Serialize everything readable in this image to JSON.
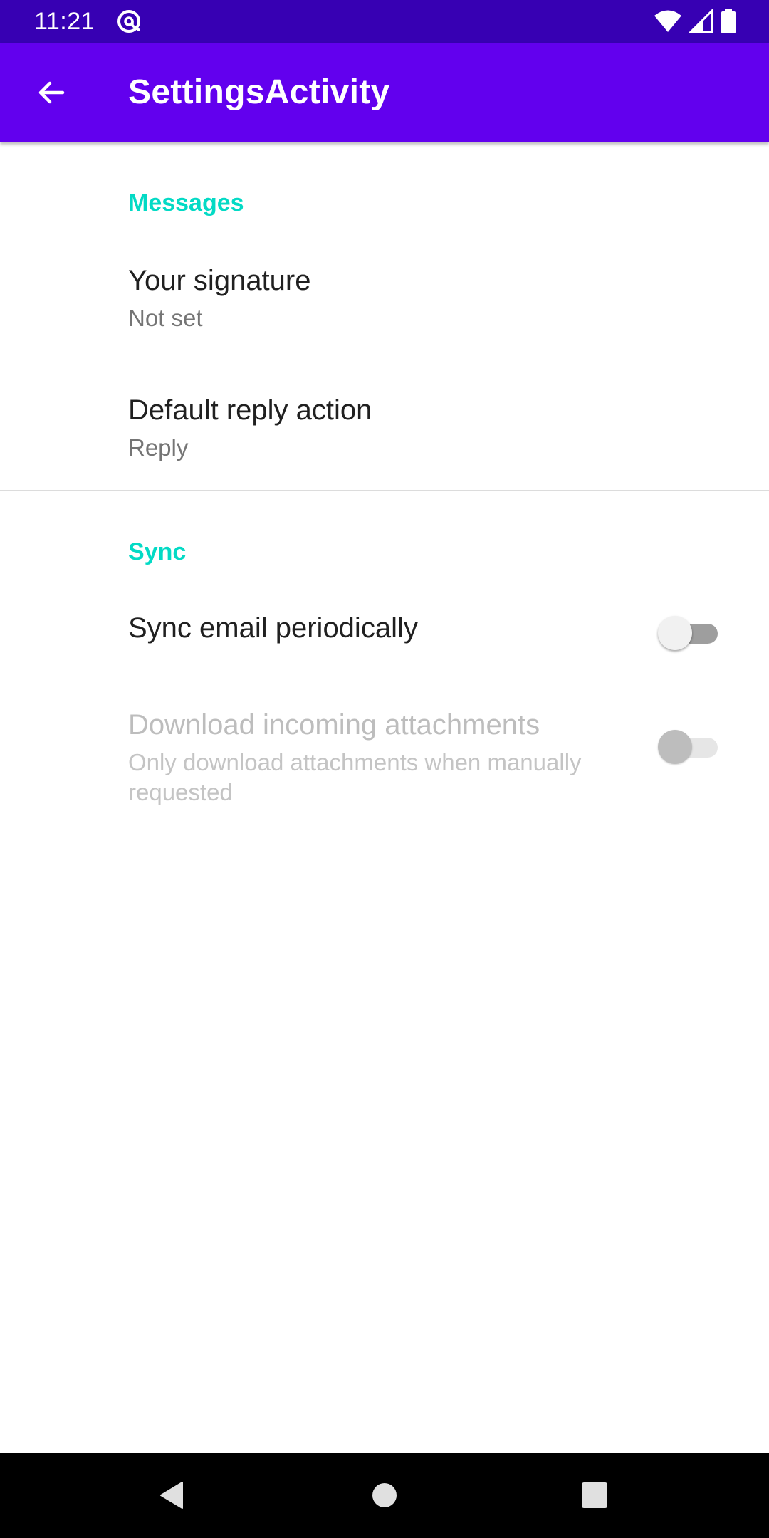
{
  "status_bar": {
    "time": "11:21",
    "icons": [
      "sync-icon",
      "wifi-icon",
      "signal-icon",
      "battery-icon"
    ]
  },
  "app_bar": {
    "title": "SettingsActivity",
    "back_icon": "arrow-back-icon",
    "color": "#6200ee",
    "status_color": "#3700b3"
  },
  "categories": [
    {
      "title": "Messages",
      "items": [
        {
          "title": "Your signature",
          "summary": "Not set"
        },
        {
          "title": "Default reply action",
          "summary": "Reply"
        }
      ]
    },
    {
      "title": "Sync",
      "items": [
        {
          "title": "Sync email periodically",
          "switch": false,
          "enabled": true
        },
        {
          "title": "Download incoming attachments",
          "summary": "Only download attachments when manually requested",
          "switch": false,
          "enabled": false
        }
      ]
    }
  ],
  "accent_color": "#03dac5",
  "nav_bar": {
    "icons": [
      "back-triangle-icon",
      "home-circle-icon",
      "recents-square-icon"
    ]
  }
}
